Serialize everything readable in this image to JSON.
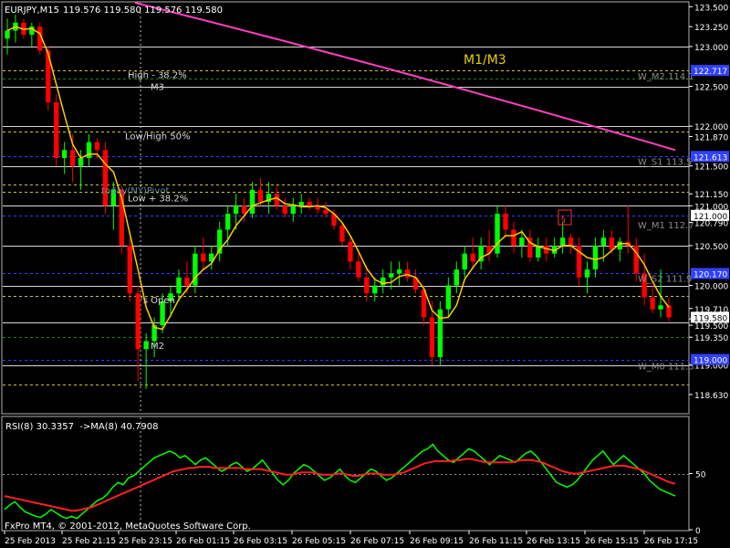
{
  "header": {
    "symbol": "EURJPY,M15",
    "ohlc": "119.576 119.580 119.576 119.580"
  },
  "footer": {
    "copyright": "FxPro MT4, © 2001-2012, MetaQuotes Software Corp."
  },
  "colors": {
    "background": "#000000",
    "bull": "#00ff00",
    "bear": "#ff0000",
    "ma_fast": "#ffcc00",
    "ma_slow": "#ff40c0",
    "rsi": "#00ff00",
    "rsi_ma": "#ff2020",
    "level_white": "#d8d8d8",
    "level_yellow": "#c8c832",
    "level_blue": "#3040ff",
    "level_green": "#208020",
    "axis_text": "#ffffff",
    "label_text": "#d8d8d8"
  },
  "chart_data": [
    {
      "type": "candlestick",
      "title": "EURJPY,M15",
      "ylim": [
        118.4,
        123.55
      ],
      "x_ticks": [
        "25 Feb 2013",
        "25 Feb 21:15",
        "25 Feb 23:15",
        "26 Feb 01:15",
        "26 Feb 03:15",
        "26 Feb 05:15",
        "26 Feb 07:15",
        "26 Feb 09:15",
        "26 Feb 11:15",
        "26 Feb 13:15",
        "26 Feb 15:15",
        "26 Feb 17:15"
      ],
      "y_ticks": [
        "123.500",
        "123.250",
        "123.000",
        "122.500",
        "122.000",
        "121.870",
        "121.500",
        "121.150",
        "121.000",
        "120.790",
        "120.500",
        "120.000",
        "119.710",
        "119.580",
        "119.500",
        "119.350",
        "119.000",
        "118.630"
      ],
      "annotations": [
        {
          "text": "M1/M3",
          "price": 122.85
        },
        {
          "text": "High - 38.2%",
          "price": 122.65
        },
        {
          "text": "M3",
          "price": 122.5
        },
        {
          "text": "Low/High 50%",
          "price": 121.88
        },
        {
          "text": "today(NY)Pivot",
          "price": 121.2
        },
        {
          "text": "Low + 38.2%",
          "price": 121.1
        },
        {
          "text": "'s Open",
          "price": 119.82
        },
        {
          "text": "M2",
          "price": 119.25
        },
        {
          "text": "W_M2 114.1",
          "price": 122.63
        },
        {
          "text": "W_S1 113.5",
          "price": 121.56
        },
        {
          "text": "W_M1 112.7",
          "price": 120.76
        },
        {
          "text": "W_S2 111.9",
          "price": 120.09
        },
        {
          "text": "W_M0 111.3",
          "price": 118.99
        }
      ],
      "levels": [
        {
          "price": 123.0,
          "style": "white"
        },
        {
          "price": 122.7,
          "style": "yellow"
        },
        {
          "price": 122.6,
          "style": "green"
        },
        {
          "price": 122.5,
          "style": "white"
        },
        {
          "price": 122.0,
          "style": "white"
        },
        {
          "price": 121.93,
          "style": "yellow"
        },
        {
          "price": 121.62,
          "style": "blue"
        },
        {
          "price": 121.5,
          "style": "white"
        },
        {
          "price": 121.27,
          "style": "yellow"
        },
        {
          "price": 121.17,
          "style": "yellow"
        },
        {
          "price": 121.0,
          "style": "white"
        },
        {
          "price": 120.88,
          "style": "blue"
        },
        {
          "price": 120.5,
          "style": "white"
        },
        {
          "price": 120.15,
          "style": "blue"
        },
        {
          "price": 120.0,
          "style": "white"
        },
        {
          "price": 119.87,
          "style": "yellow"
        },
        {
          "price": 119.53,
          "style": "white"
        },
        {
          "price": 119.35,
          "style": "green"
        },
        {
          "price": 119.07,
          "style": "blue"
        },
        {
          "price": 119.0,
          "style": "white"
        },
        {
          "price": 118.75,
          "style": "yellow"
        }
      ],
      "axis_highlights": [
        {
          "price": 122.7,
          "label": "122.717",
          "color": "#3040ff"
        },
        {
          "price": 121.62,
          "label": "121.613",
          "color": "#3040ff"
        },
        {
          "price": 120.88,
          "label": "121.000",
          "color": "#ffffff"
        },
        {
          "price": 120.15,
          "label": "120.170",
          "color": "#3040ff"
        },
        {
          "price": 119.07,
          "label": "119.000",
          "color": "#3040ff"
        },
        {
          "price": 119.6,
          "label": "119.580",
          "color": "#ffffff"
        }
      ],
      "candles": [
        [
          123.1,
          123.35,
          122.9,
          123.2
        ],
        [
          123.2,
          123.4,
          123.05,
          123.3
        ],
        [
          123.3,
          123.35,
          123.1,
          123.15
        ],
        [
          123.15,
          123.3,
          123.0,
          123.25
        ],
        [
          123.25,
          123.3,
          122.9,
          122.95
        ],
        [
          122.95,
          123.0,
          122.2,
          122.3
        ],
        [
          122.3,
          122.4,
          121.5,
          121.6
        ],
        [
          121.6,
          121.8,
          121.4,
          121.7
        ],
        [
          121.7,
          121.9,
          121.3,
          121.5
        ],
        [
          121.5,
          121.7,
          121.2,
          121.6
        ],
        [
          121.6,
          121.9,
          121.5,
          121.8
        ],
        [
          121.8,
          121.85,
          121.6,
          121.7
        ],
        [
          121.7,
          121.8,
          120.9,
          121.0
        ],
        [
          121.0,
          121.3,
          120.7,
          121.2
        ],
        [
          121.2,
          121.25,
          120.4,
          120.5
        ],
        [
          120.5,
          120.6,
          119.8,
          119.9
        ],
        [
          119.9,
          120.0,
          118.8,
          119.2
        ],
        [
          119.2,
          119.4,
          118.7,
          119.3
        ],
        [
          119.3,
          119.6,
          119.1,
          119.5
        ],
        [
          119.5,
          119.9,
          119.4,
          119.8
        ],
        [
          119.8,
          120.0,
          119.6,
          119.9
        ],
        [
          119.9,
          120.2,
          119.8,
          120.1
        ],
        [
          120.1,
          120.3,
          119.9,
          120.0
        ],
        [
          120.0,
          120.5,
          119.9,
          120.4
        ],
        [
          120.4,
          120.6,
          120.2,
          120.3
        ],
        [
          120.3,
          120.5,
          120.2,
          120.4
        ],
        [
          120.4,
          120.8,
          120.3,
          120.7
        ],
        [
          120.7,
          121.0,
          120.5,
          120.9
        ],
        [
          120.9,
          121.15,
          120.7,
          121.0
        ],
        [
          121.0,
          121.1,
          120.8,
          120.9
        ],
        [
          120.9,
          121.3,
          120.85,
          121.2
        ],
        [
          121.2,
          121.35,
          121.0,
          121.05
        ],
        [
          121.05,
          121.3,
          120.9,
          121.15
        ],
        [
          121.15,
          121.25,
          120.95,
          121.0
        ],
        [
          121.0,
          121.1,
          120.85,
          120.9
        ],
        [
          120.9,
          121.1,
          120.8,
          121.0
        ],
        [
          121.0,
          121.15,
          120.9,
          121.05
        ],
        [
          121.05,
          121.1,
          120.95,
          121.0
        ],
        [
          121.0,
          121.1,
          120.9,
          120.95
        ],
        [
          120.95,
          121.05,
          120.85,
          120.9
        ],
        [
          120.9,
          120.95,
          120.7,
          120.75
        ],
        [
          120.75,
          120.8,
          120.5,
          120.55
        ],
        [
          120.55,
          120.6,
          120.2,
          120.3
        ],
        [
          120.3,
          120.4,
          120.05,
          120.1
        ],
        [
          120.1,
          120.25,
          119.8,
          119.9
        ],
        [
          119.9,
          120.1,
          119.8,
          120.0
        ],
        [
          120.0,
          120.2,
          119.9,
          120.1
        ],
        [
          120.1,
          120.3,
          119.95,
          120.15
        ],
        [
          120.15,
          120.3,
          120.0,
          120.2
        ],
        [
          120.2,
          120.3,
          120.05,
          120.1
        ],
        [
          120.1,
          120.2,
          119.9,
          119.95
        ],
        [
          119.95,
          120.0,
          119.5,
          119.6
        ],
        [
          119.6,
          119.8,
          119.0,
          119.1
        ],
        [
          119.1,
          119.8,
          119.0,
          119.7
        ],
        [
          119.7,
          120.1,
          119.6,
          120.0
        ],
        [
          120.0,
          120.3,
          119.9,
          120.2
        ],
        [
          120.2,
          120.5,
          120.1,
          120.4
        ],
        [
          120.4,
          120.6,
          120.2,
          120.3
        ],
        [
          120.3,
          120.6,
          120.2,
          120.5
        ],
        [
          120.5,
          120.7,
          120.3,
          120.4
        ],
        [
          120.4,
          121.0,
          120.35,
          120.9
        ],
        [
          120.9,
          121.0,
          120.6,
          120.7
        ],
        [
          120.7,
          120.8,
          120.4,
          120.5
        ],
        [
          120.5,
          120.7,
          120.35,
          120.6
        ],
        [
          120.6,
          120.7,
          120.3,
          120.35
        ],
        [
          120.35,
          120.6,
          120.3,
          120.5
        ],
        [
          120.5,
          120.6,
          120.3,
          120.4
        ],
        [
          120.4,
          120.6,
          120.35,
          120.5
        ],
        [
          120.5,
          120.8,
          120.4,
          120.6
        ],
        [
          120.6,
          120.65,
          120.4,
          120.5
        ],
        [
          120.5,
          120.6,
          120.0,
          120.1
        ],
        [
          120.1,
          120.3,
          119.9,
          120.2
        ],
        [
          120.2,
          120.6,
          120.1,
          120.5
        ],
        [
          120.5,
          120.7,
          120.3,
          120.6
        ],
        [
          120.6,
          120.7,
          120.4,
          120.45
        ],
        [
          120.45,
          120.6,
          120.3,
          120.55
        ],
        [
          120.55,
          121.0,
          120.4,
          120.5
        ],
        [
          120.5,
          120.6,
          120.05,
          120.15
        ],
        [
          120.15,
          120.4,
          119.75,
          119.85
        ],
        [
          119.85,
          120.0,
          119.65,
          119.7
        ],
        [
          119.7,
          120.2,
          119.6,
          119.75
        ],
        [
          119.75,
          119.85,
          119.55,
          119.6
        ]
      ]
    },
    {
      "type": "line",
      "title": "RSI(8) 30.3357  ->MA(8) 40.7908",
      "ylim": [
        0,
        100
      ],
      "y_ticks": [
        "50",
        "0"
      ],
      "levels": [
        50
      ],
      "series": [
        {
          "name": "RSI(8)",
          "values": [
            18,
            22,
            25,
            20,
            16,
            14,
            12,
            11,
            14,
            18,
            15,
            12,
            10,
            12,
            10,
            14,
            18,
            22,
            26,
            28,
            32,
            38,
            42,
            40,
            46,
            48,
            52,
            56,
            60,
            64,
            66,
            68,
            70,
            68,
            64,
            66,
            62,
            58,
            62,
            64,
            60,
            56,
            52,
            54,
            58,
            60,
            56,
            52,
            54,
            58,
            62,
            56,
            50,
            44,
            40,
            44,
            50,
            54,
            58,
            56,
            52,
            48,
            44,
            46,
            50,
            54,
            48,
            44,
            42,
            46,
            50,
            54,
            52,
            48,
            44,
            46,
            50,
            54,
            58,
            62,
            66,
            70,
            72,
            76,
            70,
            66,
            62,
            60,
            64,
            68,
            72,
            70,
            66,
            62,
            58,
            62,
            66,
            64,
            62,
            60,
            64,
            68,
            70,
            66,
            60,
            54,
            48,
            42,
            40,
            38,
            40,
            44,
            50,
            56,
            62,
            66,
            70,
            64,
            58,
            62,
            66,
            62,
            58,
            54,
            50,
            44,
            40,
            36,
            34,
            32,
            30
          ]
        },
        {
          "name": "MA(8)",
          "values": [
            30,
            29,
            28,
            27,
            26,
            25,
            24,
            23,
            22,
            21,
            20,
            19,
            18,
            17,
            17,
            18,
            19,
            20,
            22,
            24,
            26,
            28,
            30,
            32,
            34,
            36,
            38,
            40,
            42,
            44,
            46,
            48,
            50,
            52,
            53,
            54,
            55,
            55,
            56,
            56,
            56,
            55,
            55,
            55,
            55,
            55,
            55,
            54,
            54,
            54,
            54,
            53,
            52,
            51,
            50,
            49,
            49,
            50,
            51,
            51,
            51,
            50,
            49,
            49,
            49,
            50,
            50,
            49,
            48,
            48,
            49,
            50,
            50,
            50,
            49,
            49,
            49,
            50,
            51,
            53,
            55,
            57,
            59,
            60,
            61,
            61,
            61,
            61,
            62,
            62,
            63,
            63,
            62,
            61,
            60,
            60,
            60,
            60,
            60,
            60,
            61,
            62,
            62,
            62,
            61,
            60,
            58,
            56,
            54,
            52,
            51,
            50,
            50,
            51,
            52,
            53,
            54,
            55,
            56,
            57,
            57,
            57,
            56,
            55,
            54,
            52,
            50,
            48,
            46,
            44,
            42,
            41
          ]
        }
      ]
    }
  ]
}
